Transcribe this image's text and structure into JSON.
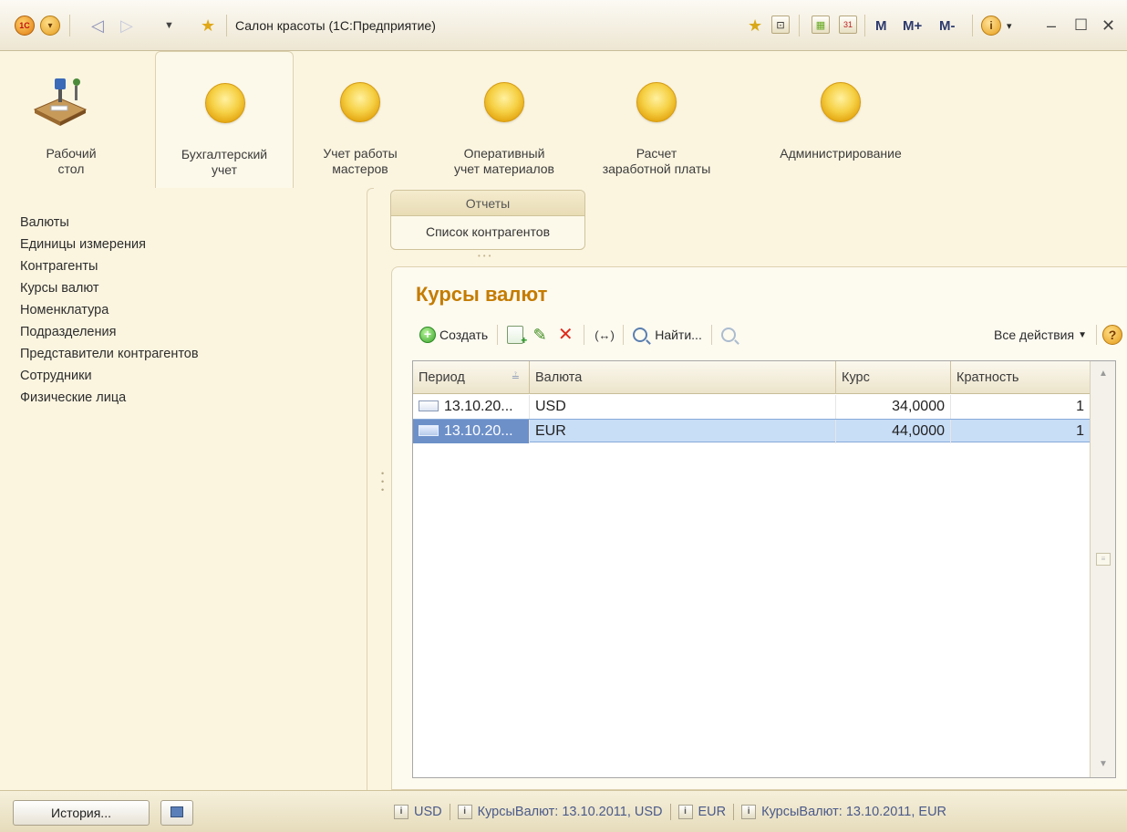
{
  "window": {
    "title": "Салон красоты (1С:Предприятие)",
    "logo_text": "1С",
    "memory_buttons": [
      "M",
      "M+",
      "M-"
    ]
  },
  "sections": [
    {
      "label": "Рабочий\nстол",
      "icon": "desk-icon",
      "active": false
    },
    {
      "label": "Бухгалтерский\nучет",
      "icon": "section-icon",
      "active": true
    },
    {
      "label": "Учет работы\nмастеров",
      "icon": "section-icon",
      "active": false
    },
    {
      "label": "Оперативный\nучет материалов",
      "icon": "section-icon",
      "active": false
    },
    {
      "label": "Расчет\nзаработной платы",
      "icon": "section-icon",
      "active": false
    },
    {
      "label": "Администрирование",
      "icon": "section-icon",
      "active": false
    }
  ],
  "nav": {
    "items": [
      "Валюты",
      "Единицы измерения",
      "Контрагенты",
      "Курсы валют",
      "Номенклатура",
      "Подразделения",
      "Представители контрагентов",
      "Сотрудники",
      "Физические лица"
    ]
  },
  "tabs": {
    "reports": "Отчеты",
    "counterparties": "Список контрагентов"
  },
  "form": {
    "title": "Курсы валют",
    "toolbar": {
      "create": "Создать",
      "find": "Найти...",
      "all_actions": "Все действия",
      "help": "?"
    },
    "table": {
      "columns": [
        "Период",
        "Валюта",
        "Курс",
        "Кратность"
      ],
      "rows": [
        {
          "period": "13.10.20...",
          "currency": "USD",
          "rate": "34,0000",
          "multiplier": "1"
        },
        {
          "period": "13.10.20...",
          "currency": "EUR",
          "rate": "44,0000",
          "multiplier": "1"
        }
      ]
    }
  },
  "statusbar": {
    "history": "История...",
    "items": [
      "USD",
      "КурсыВалют: 13.10.2011, USD",
      "EUR",
      "КурсыВалют: 13.10.2011, EUR"
    ]
  },
  "colors": {
    "accent_title": "#c47c00",
    "selection": "#c8ddf6",
    "background": "#fbf5e0"
  }
}
